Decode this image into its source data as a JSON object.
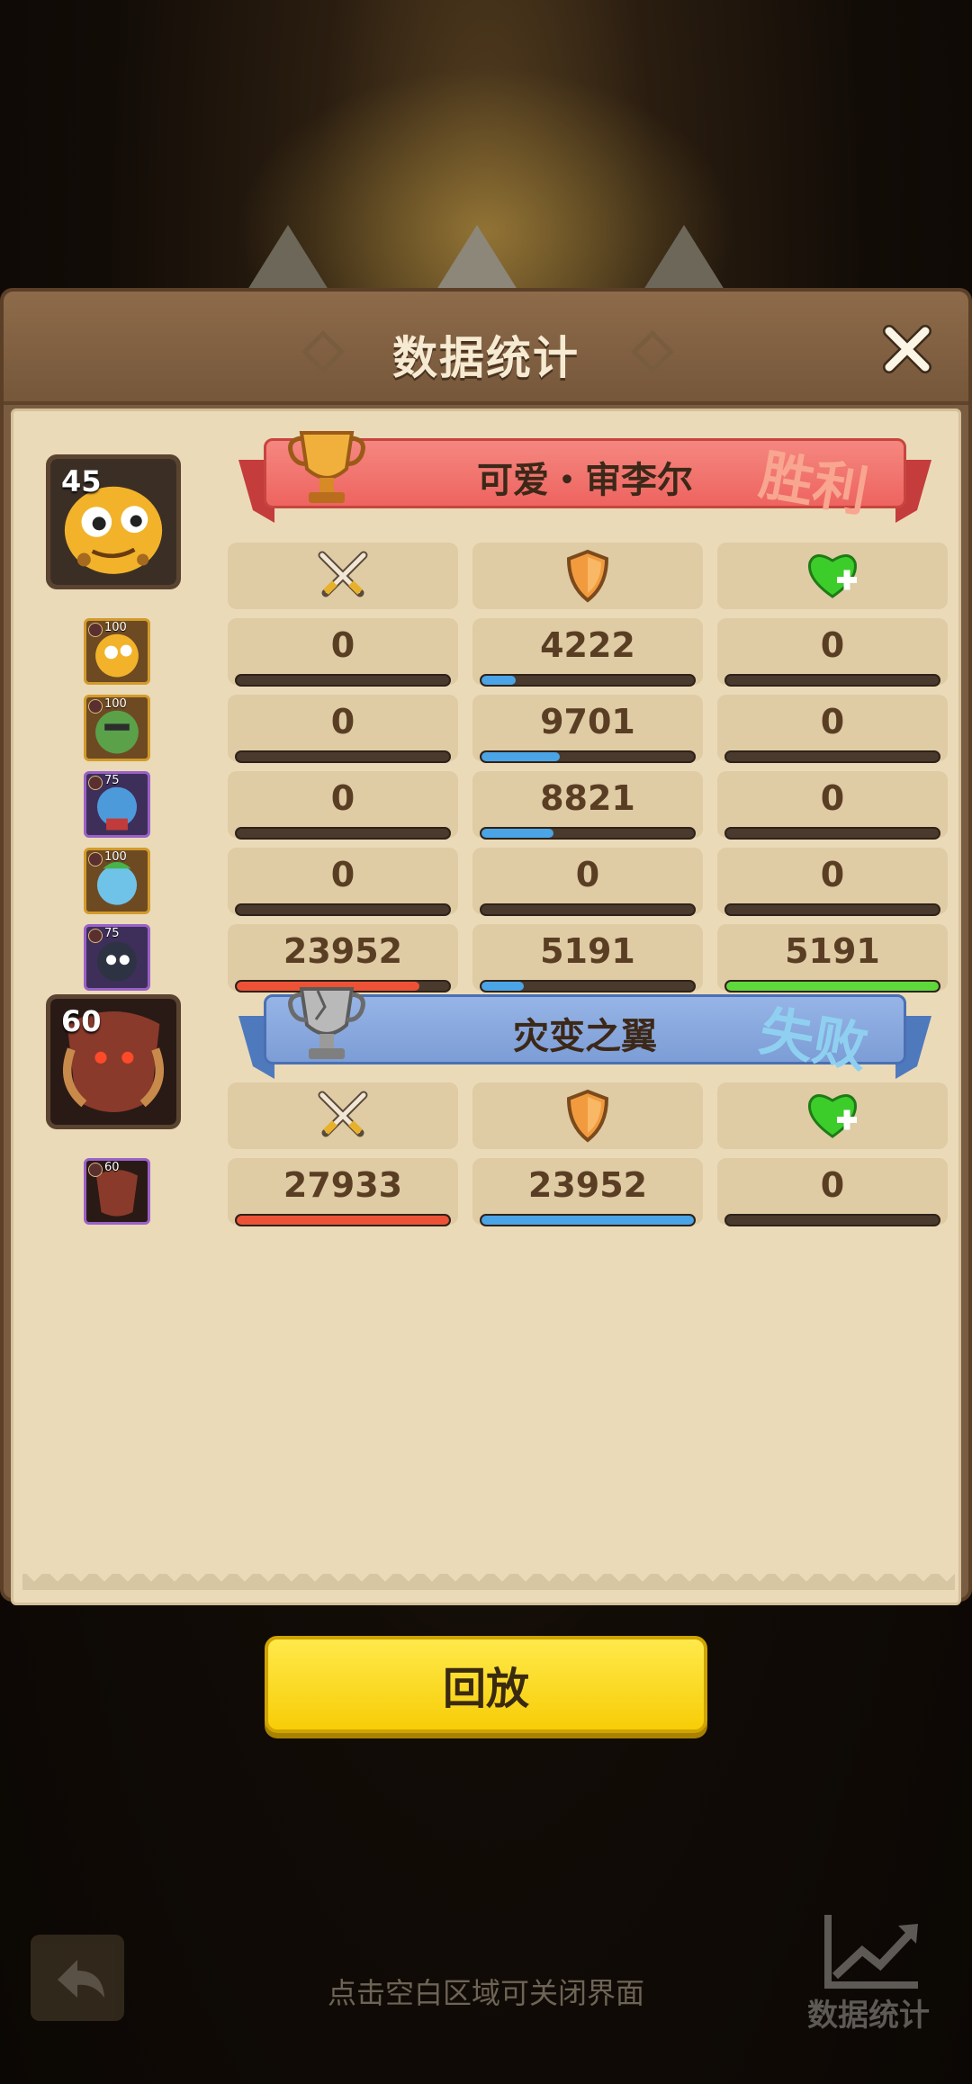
{
  "panel": {
    "title": "数据统计",
    "close_icon": "close-icon"
  },
  "teams": [
    {
      "name": "可爱・审李尔",
      "result": "胜利",
      "result_color": "#f8a690",
      "banner_color": "#f06d67",
      "leader_level": "45",
      "trophy": "gold-trophy-icon",
      "columns": [
        "damage-icon",
        "defense-icon",
        "heal-icon"
      ],
      "heroes": [
        {
          "level": "100",
          "frame": "gold",
          "stats": [
            "0",
            "4222",
            "0"
          ],
          "bars": [
            0,
            0.16,
            0
          ]
        },
        {
          "level": "100",
          "frame": "gold",
          "stats": [
            "0",
            "9701",
            "0"
          ],
          "bars": [
            0,
            0.37,
            0
          ]
        },
        {
          "level": "75",
          "frame": "purple",
          "stats": [
            "0",
            "8821",
            "0"
          ],
          "bars": [
            0,
            0.34,
            0
          ]
        },
        {
          "level": "100",
          "frame": "gold",
          "stats": [
            "0",
            "0",
            "0"
          ],
          "bars": [
            0,
            0,
            0
          ]
        },
        {
          "level": "75",
          "frame": "purple",
          "stats": [
            "23952",
            "5191",
            "5191"
          ],
          "bars": [
            0.86,
            0.2,
            1.0
          ]
        }
      ]
    },
    {
      "name": "灾变之翼",
      "result": "失败",
      "result_color": "#8fd0f0",
      "banner_color": "#7e9fd6",
      "leader_level": "60",
      "trophy": "silver-trophy-icon",
      "columns": [
        "damage-icon",
        "defense-icon",
        "heal-icon"
      ],
      "heroes": [
        {
          "level": "60",
          "frame": "purple",
          "stats": [
            "27933",
            "23952",
            "0"
          ],
          "bars": [
            1.0,
            1.0,
            0
          ]
        }
      ]
    }
  ],
  "bar_colors": {
    "damage": "#ee5236",
    "defense": "#4aa4e6",
    "heal": "#5fd83c"
  },
  "buttons": {
    "replay": "回放"
  },
  "footer": {
    "hint": "点击空白区域可关闭界面",
    "stats_shortcut": "数据统计",
    "back_icon": "back-arrow-icon",
    "chart_icon": "chart-trend-icon"
  }
}
